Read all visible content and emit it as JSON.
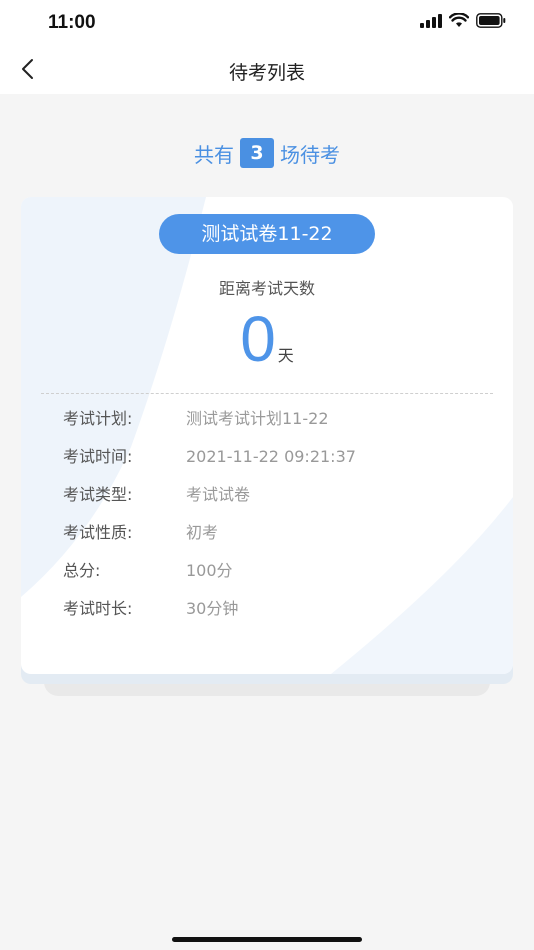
{
  "status_bar": {
    "time": "11:00"
  },
  "nav": {
    "title": "待考列表"
  },
  "summary": {
    "prefix": "共有",
    "count": "3",
    "suffix": "场待考"
  },
  "exam_card": {
    "name": "测试试卷11-22",
    "countdown_label": "距离考试天数",
    "days": "0",
    "days_unit": "天",
    "details": [
      {
        "label": "考试计划:",
        "value": "测试考试计划11-22"
      },
      {
        "label": "考试时间:",
        "value": "2021-11-22 09:21:37"
      },
      {
        "label": "考试类型:",
        "value": "考试试卷"
      },
      {
        "label": "考试性质:",
        "value": "初考"
      },
      {
        "label": "总分:",
        "value": "100分"
      },
      {
        "label": "考试时长:",
        "value": "30分钟"
      }
    ]
  },
  "colors": {
    "accent": "#4e94e8",
    "background": "#f5f5f5"
  }
}
